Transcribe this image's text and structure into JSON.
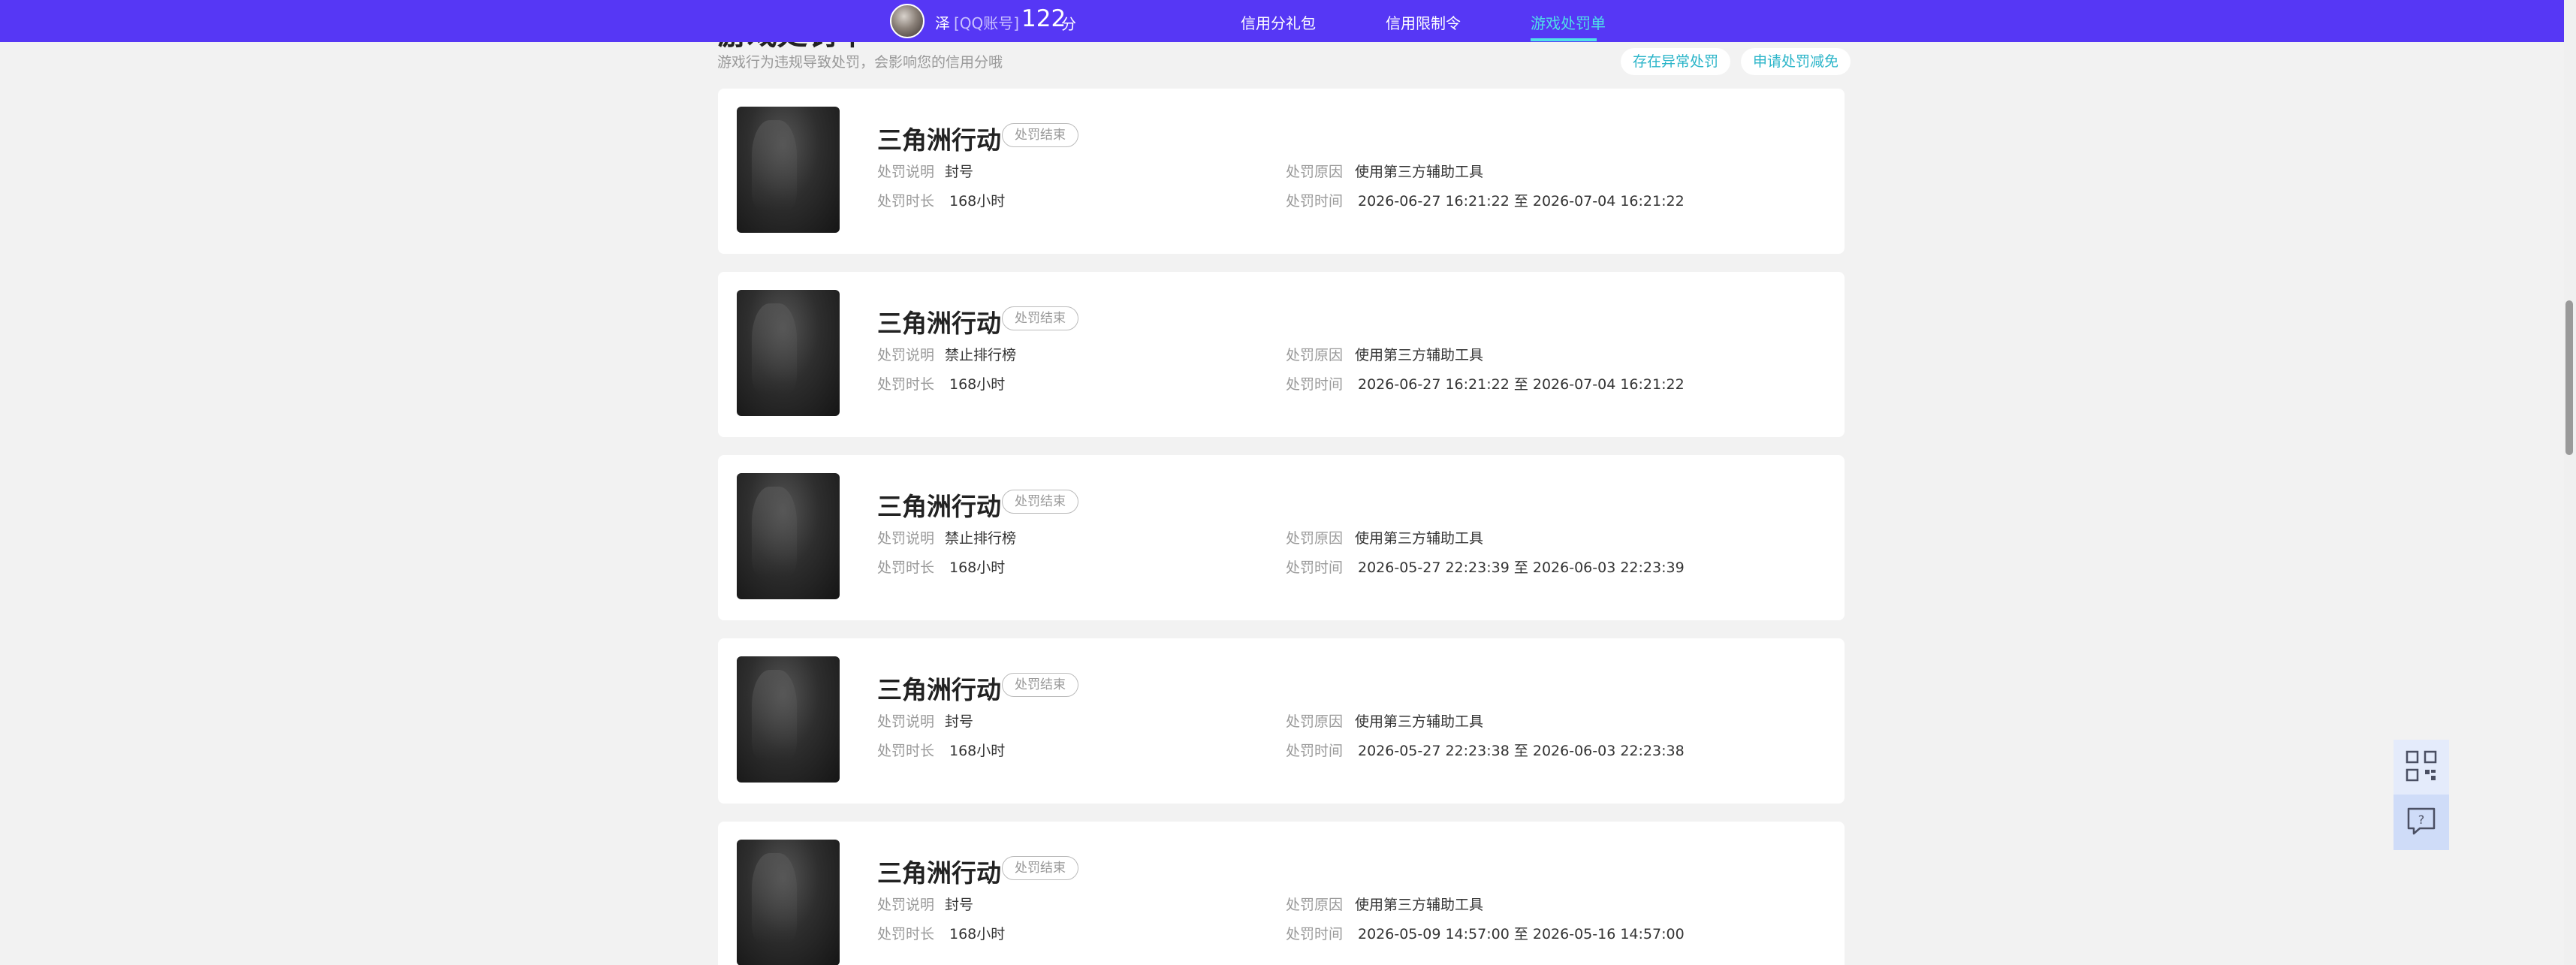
{
  "header": {
    "user_name": "泽",
    "account_type": "[QQ账号]",
    "score": "122",
    "score_unit": "分",
    "nav": [
      {
        "label": "信用分礼包"
      },
      {
        "label": "信用限制令"
      },
      {
        "label": "游戏处罚单",
        "active": true
      }
    ]
  },
  "section": {
    "title": "游戏处罚单",
    "description": "游戏行为违规导致处罚，会影响您的信用分哦",
    "actions": [
      "存在异常处罚",
      "申请处罚减免"
    ]
  },
  "labels": {
    "desc": "处罚说明",
    "reason": "处罚原因",
    "duration": "处罚时长",
    "time": "处罚时间"
  },
  "penalties": [
    {
      "game": "三角洲行动",
      "status": "处罚结束",
      "desc": "封号",
      "reason": "使用第三方辅助工具",
      "duration": "168小时",
      "time": "2026-06-27 16:21:22 至 2026-07-04 16:21:22"
    },
    {
      "game": "三角洲行动",
      "status": "处罚结束",
      "desc": "禁止排行榜",
      "reason": "使用第三方辅助工具",
      "duration": "168小时",
      "time": "2026-06-27 16:21:22 至 2026-07-04 16:21:22"
    },
    {
      "game": "三角洲行动",
      "status": "处罚结束",
      "desc": "禁止排行榜",
      "reason": "使用第三方辅助工具",
      "duration": "168小时",
      "time": "2026-05-27 22:23:39 至 2026-06-03 22:23:39"
    },
    {
      "game": "三角洲行动",
      "status": "处罚结束",
      "desc": "封号",
      "reason": "使用第三方辅助工具",
      "duration": "168小时",
      "time": "2026-05-27 22:23:38 至 2026-06-03 22:23:38"
    },
    {
      "game": "三角洲行动",
      "status": "处罚结束",
      "desc": "封号",
      "reason": "使用第三方辅助工具",
      "duration": "168小时",
      "time": "2026-05-09 14:57:00 至 2026-05-16 14:57:00"
    }
  ],
  "floating_tools": [
    {
      "icon": "qr-code-icon"
    },
    {
      "icon": "help-chat-icon"
    }
  ],
  "colors": {
    "topbar": "#5637f5",
    "active_nav": "#4fe0e7",
    "accent": "#2bb5c9"
  }
}
